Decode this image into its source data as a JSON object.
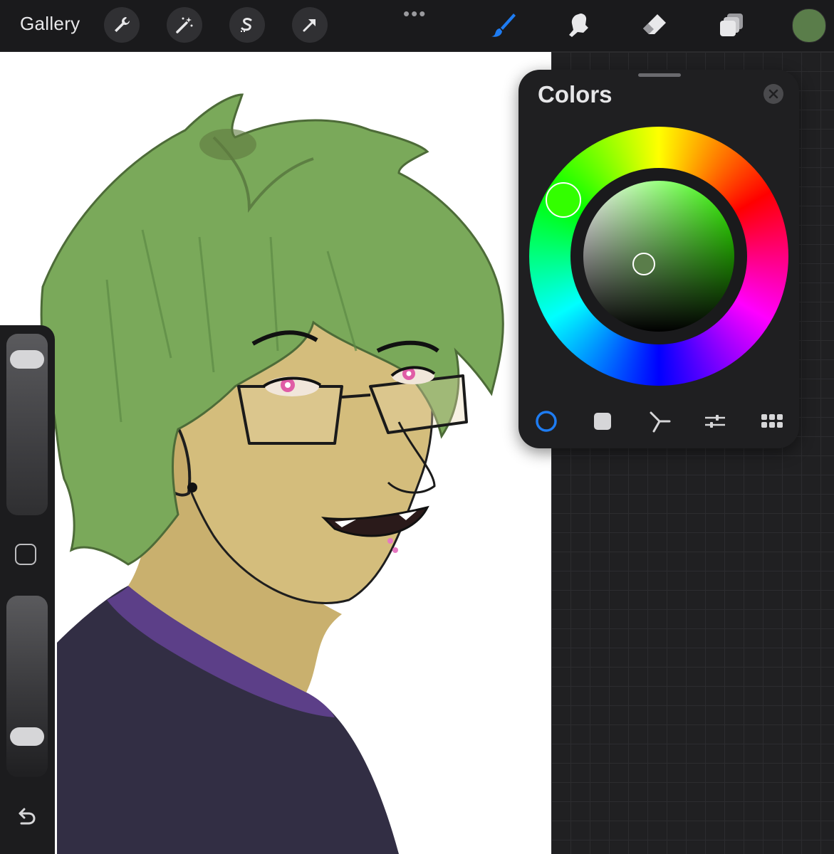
{
  "toolbar": {
    "gallery_label": "Gallery",
    "more_dots": "•••",
    "left_tools": [
      {
        "name": "actions",
        "icon": "wrench-icon"
      },
      {
        "name": "adjustments",
        "icon": "magic-wand-icon"
      },
      {
        "name": "selection",
        "icon": "selection-s-icon"
      },
      {
        "name": "transform",
        "icon": "arrow-cursor-icon"
      }
    ],
    "right_tools": [
      {
        "name": "brush",
        "icon": "brush-icon",
        "active": true
      },
      {
        "name": "smudge",
        "icon": "smudge-finger-icon"
      },
      {
        "name": "eraser",
        "icon": "eraser-icon"
      },
      {
        "name": "layers",
        "icon": "layers-icon"
      }
    ],
    "current_color": "#5a7d4a",
    "active_color": "#1e7cf2",
    "icon_color": "#e8e8ea"
  },
  "sidebar": {
    "brush_size_level": 0.92,
    "opacity_level": 0.18,
    "modify_icon": "square-outline-icon",
    "undo_icon": "undo-arrow-icon"
  },
  "colors_panel": {
    "title": "Colors",
    "close_icon": "close-x-icon",
    "mode": "disc",
    "selected_hue": "#33ff00",
    "selected_color": "#5a7d4a",
    "tabs": [
      {
        "name": "disc",
        "icon": "circle-outline-icon",
        "active": true
      },
      {
        "name": "classic",
        "icon": "filled-square-icon"
      },
      {
        "name": "harmony",
        "icon": "harmony-y-icon"
      },
      {
        "name": "value",
        "icon": "sliders-icon"
      },
      {
        "name": "palettes",
        "icon": "grid-palette-icon"
      }
    ]
  },
  "canvas": {
    "artwork": "illustration"
  }
}
